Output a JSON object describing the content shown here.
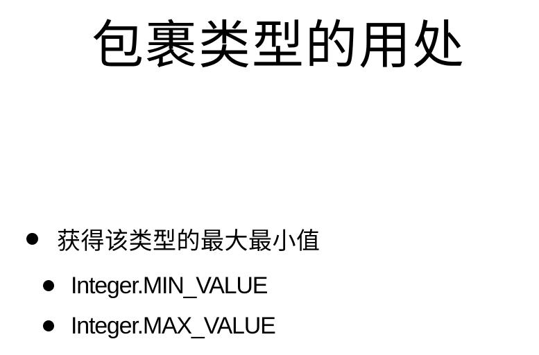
{
  "slide": {
    "title": "包裹类型的用处",
    "bullets": [
      {
        "text": "获得该类型的最大最小值",
        "sub_bullets": [
          {
            "text": "Integer.MIN_VALUE"
          },
          {
            "text": "Integer.MAX_VALUE"
          }
        ]
      }
    ]
  }
}
